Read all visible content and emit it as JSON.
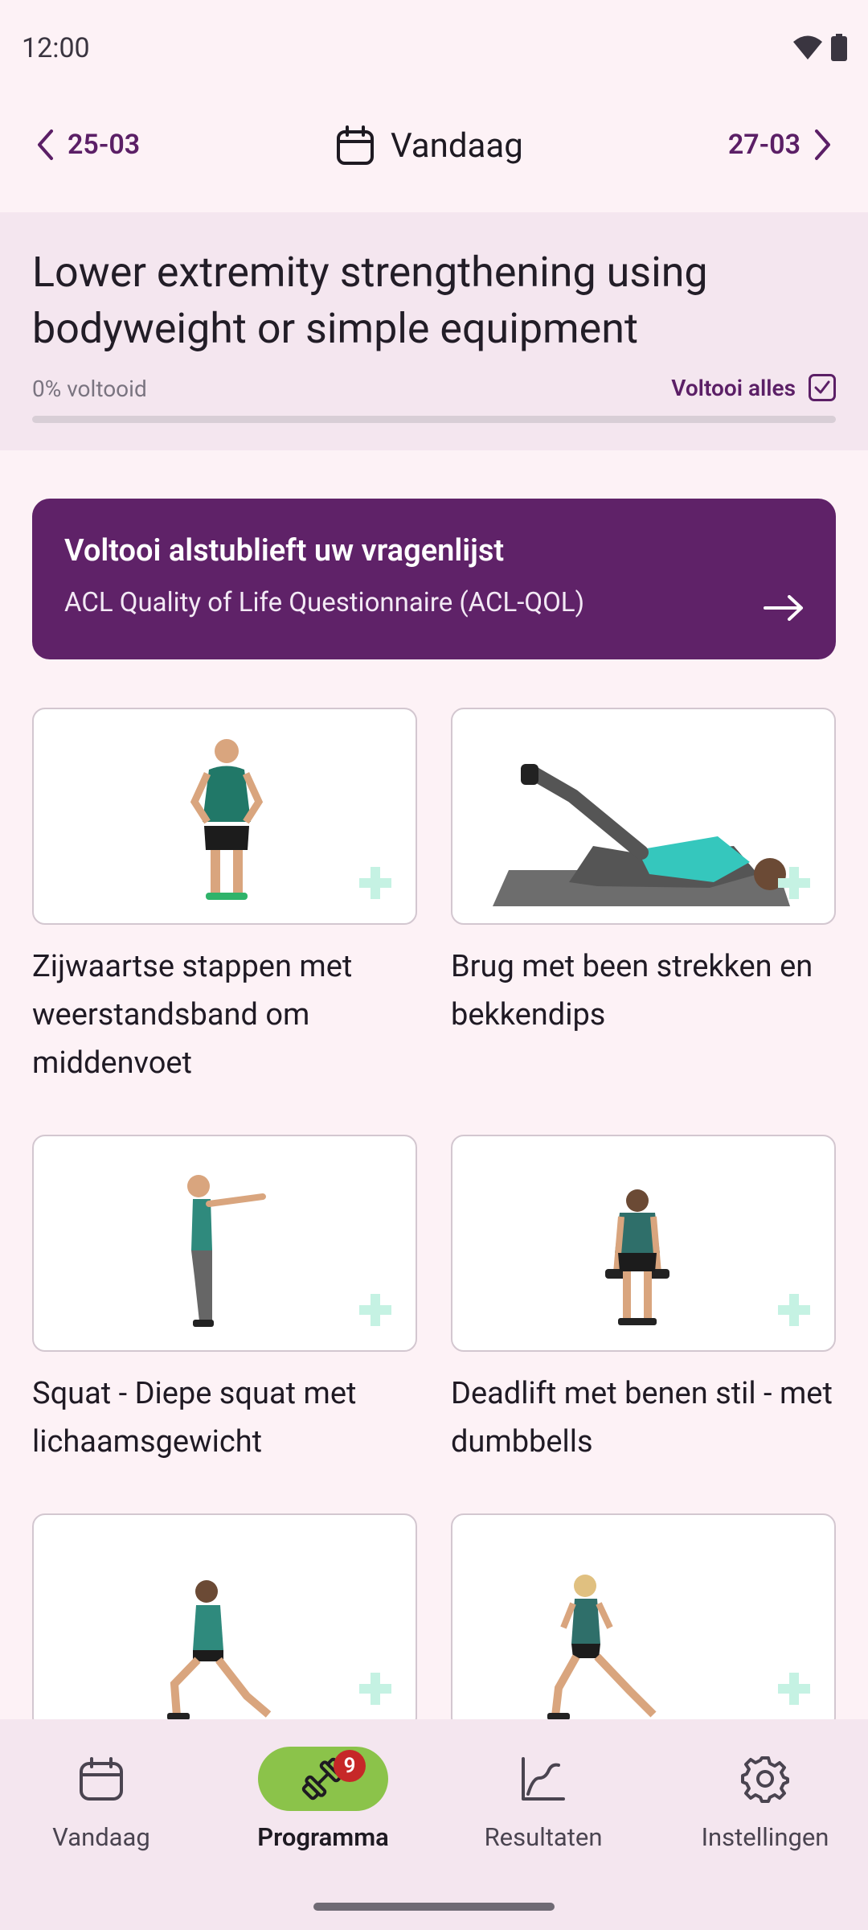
{
  "status_bar": {
    "time": "12:00"
  },
  "date_nav": {
    "prev_label": "25-03",
    "current_label": "Vandaag",
    "next_label": "27-03"
  },
  "program": {
    "title": "Lower extremity strengthening using bodyweight or simple equipment",
    "progress_label": "0% voltooid",
    "progress_fraction": 0,
    "complete_all_label": "Voltooi alles"
  },
  "questionnaire": {
    "title": "Voltooi alstublieft uw vragenlijst",
    "subtitle": "ACL Quality of Life Questionnaire (ACL-QOL)"
  },
  "exercises": [
    {
      "title": "Zijwaartse stappen met weerstandsband om middenvoet",
      "image": "standing-band-figure"
    },
    {
      "title": "Brug met been strekken en bekkendips",
      "image": "bridge-leg-raise-figure"
    },
    {
      "title": "Squat - Diepe squat met lichaamsgewicht",
      "image": "squat-figure"
    },
    {
      "title": "Deadlift met benen stil - met dumbbells",
      "image": "deadlift-figure"
    },
    {
      "title": "",
      "image": "lunge-figure"
    },
    {
      "title": "",
      "image": "side-lunge-figure"
    }
  ],
  "bottom_nav": {
    "items": [
      {
        "label": "Vandaag",
        "icon": "calendar-icon",
        "active": false
      },
      {
        "label": "Programma",
        "icon": "dumbbell-icon",
        "active": true,
        "badge": "9"
      },
      {
        "label": "Resultaten",
        "icon": "chart-icon",
        "active": false
      },
      {
        "label": "Instellingen",
        "icon": "gear-icon",
        "active": false
      }
    ]
  },
  "colors": {
    "brand": "#5f2268",
    "active_nav": "#8bc34a",
    "badge": "#c62828",
    "background": "#fdf2f6"
  }
}
